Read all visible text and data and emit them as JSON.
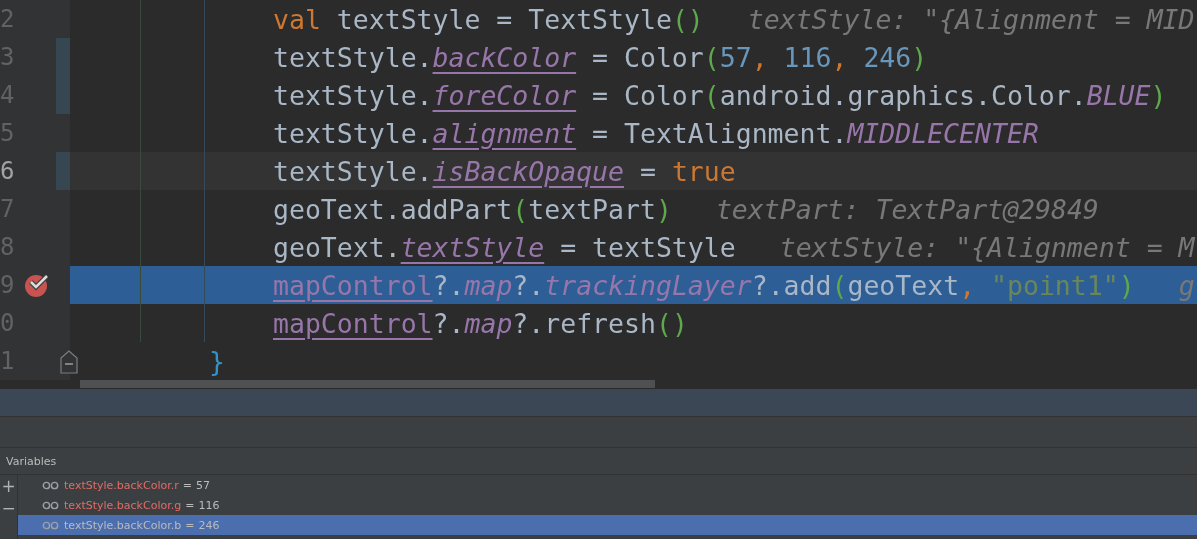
{
  "editor": {
    "lines": [
      {
        "number": "2",
        "kind": "statement",
        "current": false,
        "changed": false,
        "execution_point": false,
        "breakpoint": false,
        "fold": false,
        "tokens": [
          {
            "kind": "keyword",
            "text": "val"
          },
          {
            "kind": "plain",
            "text": " textStyle = TextStyle"
          },
          {
            "kind": "paren",
            "text": "()"
          }
        ],
        "hint": "textStyle: \"{Alignment = MID"
      },
      {
        "number": "3",
        "kind": "statement",
        "current": false,
        "changed": true,
        "execution_point": false,
        "breakpoint": false,
        "fold": false,
        "tokens": [
          {
            "kind": "plain",
            "text": "textStyle."
          },
          {
            "kind": "property",
            "text": "backColor"
          },
          {
            "kind": "plain",
            "text": " = Color"
          },
          {
            "kind": "paren",
            "text": "("
          },
          {
            "kind": "number",
            "text": "57"
          },
          {
            "kind": "comma",
            "text": ", "
          },
          {
            "kind": "number",
            "text": "116"
          },
          {
            "kind": "comma",
            "text": ", "
          },
          {
            "kind": "number",
            "text": "246"
          },
          {
            "kind": "paren",
            "text": ")"
          }
        ]
      },
      {
        "number": "4",
        "kind": "statement",
        "current": false,
        "changed": true,
        "execution_point": false,
        "breakpoint": false,
        "fold": false,
        "tokens": [
          {
            "kind": "plain",
            "text": "textStyle."
          },
          {
            "kind": "property",
            "text": "foreColor"
          },
          {
            "kind": "plain",
            "text": " = Color"
          },
          {
            "kind": "paren",
            "text": "("
          },
          {
            "kind": "plain",
            "text": "android.graphics.Color."
          },
          {
            "kind": "constant",
            "text": "BLUE"
          },
          {
            "kind": "paren",
            "text": ")"
          }
        ]
      },
      {
        "number": "5",
        "kind": "statement",
        "current": false,
        "changed": false,
        "execution_point": false,
        "breakpoint": false,
        "fold": false,
        "tokens": [
          {
            "kind": "plain",
            "text": "textStyle."
          },
          {
            "kind": "property",
            "text": "alignment"
          },
          {
            "kind": "plain",
            "text": " = TextAlignment."
          },
          {
            "kind": "constant",
            "text": "MIDDLECENTER"
          }
        ]
      },
      {
        "number": "6",
        "kind": "statement",
        "current": true,
        "changed": true,
        "execution_point": false,
        "breakpoint": false,
        "fold": false,
        "tokens": [
          {
            "kind": "plain",
            "text": "textStyle."
          },
          {
            "kind": "property",
            "text": "isBackOpaque"
          },
          {
            "kind": "plain",
            "text": " = "
          },
          {
            "kind": "keyword",
            "text": "true"
          }
        ]
      },
      {
        "number": "7",
        "kind": "statement",
        "current": false,
        "changed": false,
        "execution_point": false,
        "breakpoint": false,
        "fold": false,
        "tokens": [
          {
            "kind": "plain",
            "text": "geoText.addPart"
          },
          {
            "kind": "paren",
            "text": "("
          },
          {
            "kind": "plain",
            "text": "textPart"
          },
          {
            "kind": "paren",
            "text": ")"
          }
        ],
        "hint": "textPart: TextPart@29849"
      },
      {
        "number": "8",
        "kind": "statement",
        "current": false,
        "changed": false,
        "execution_point": false,
        "breakpoint": false,
        "fold": false,
        "tokens": [
          {
            "kind": "plain",
            "text": "geoText."
          },
          {
            "kind": "property",
            "text": "textStyle"
          },
          {
            "kind": "plain",
            "text": " = textStyle"
          }
        ],
        "hint": "textStyle: \"{Alignment = M"
      },
      {
        "number": "9",
        "kind": "statement",
        "current": false,
        "changed": false,
        "execution_point": true,
        "breakpoint": true,
        "fold": false,
        "tokens": [
          {
            "kind": "reference",
            "text": "mapControl"
          },
          {
            "kind": "plain",
            "text": "?."
          },
          {
            "kind": "constant",
            "text": "map"
          },
          {
            "kind": "plain",
            "text": "?."
          },
          {
            "kind": "constant",
            "text": "trackingLayer"
          },
          {
            "kind": "plain",
            "text": "?.add"
          },
          {
            "kind": "paren",
            "text": "("
          },
          {
            "kind": "plain",
            "text": "geoText"
          },
          {
            "kind": "comma",
            "text": ", "
          },
          {
            "kind": "string",
            "text": "\"point1\""
          },
          {
            "kind": "paren",
            "text": ")"
          }
        ],
        "hint": "g"
      },
      {
        "number": "0",
        "kind": "statement",
        "current": false,
        "changed": false,
        "execution_point": false,
        "breakpoint": false,
        "fold": false,
        "tokens": [
          {
            "kind": "reference",
            "text": "mapControl"
          },
          {
            "kind": "plain",
            "text": "?."
          },
          {
            "kind": "constant",
            "text": "map"
          },
          {
            "kind": "plain",
            "text": "?.refresh"
          },
          {
            "kind": "paren",
            "text": "()"
          }
        ]
      },
      {
        "number": "1",
        "kind": "block_end",
        "current": false,
        "changed": false,
        "execution_point": false,
        "breakpoint": false,
        "fold": true,
        "tokens": [
          {
            "kind": "brace",
            "text": "}"
          }
        ]
      }
    ]
  },
  "variables": {
    "title": "Variables",
    "tools": [
      "+",
      "−"
    ],
    "items": [
      {
        "name": "textStyle.backColor.r",
        "operator": "=",
        "value": "57",
        "selected": false
      },
      {
        "name": "textStyle.backColor.g",
        "operator": "=",
        "value": "116",
        "selected": false
      },
      {
        "name": "textStyle.backColor.b",
        "operator": "=",
        "value": "246",
        "selected": true
      }
    ]
  }
}
